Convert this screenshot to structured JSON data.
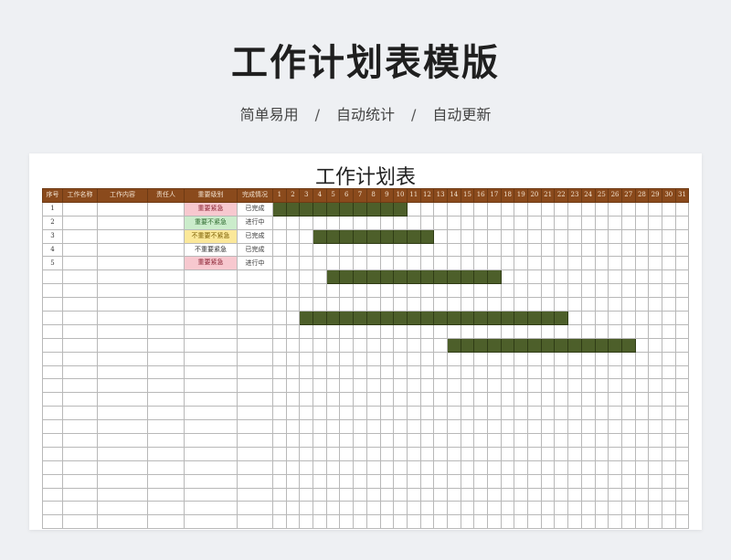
{
  "header": {
    "title": "工作计划表模版",
    "subtitle_items": [
      "简单易用",
      "自动统计",
      "自动更新"
    ],
    "separator": "/"
  },
  "sheet": {
    "title": "工作计划表",
    "columns": [
      "序号",
      "工作名称",
      "工作内容",
      "责任人",
      "重要级别",
      "完成情况"
    ],
    "days": [
      "1",
      "2",
      "3",
      "4",
      "5",
      "6",
      "7",
      "8",
      "9",
      "10",
      "11",
      "12",
      "13",
      "14",
      "15",
      "16",
      "17",
      "18",
      "19",
      "20",
      "21",
      "22",
      "23",
      "24",
      "25",
      "26",
      "27",
      "28",
      "29",
      "30",
      "31"
    ],
    "rows": [
      {
        "no": "1",
        "name": "",
        "content": "",
        "owner": "",
        "priority": "重要紧急",
        "priority_style": "red",
        "status": "已完成",
        "bar": [
          1,
          10
        ]
      },
      {
        "no": "2",
        "name": "",
        "content": "",
        "owner": "",
        "priority": "重要不紧急",
        "priority_style": "green",
        "status": "进行中",
        "bar": null
      },
      {
        "no": "3",
        "name": "",
        "content": "",
        "owner": "",
        "priority": "不重要不紧急",
        "priority_style": "yellow",
        "status": "已完成",
        "bar": [
          4,
          12
        ]
      },
      {
        "no": "4",
        "name": "",
        "content": "",
        "owner": "",
        "priority": "不重要紧急",
        "priority_style": "none",
        "status": "已完成",
        "bar": null
      },
      {
        "no": "5",
        "name": "",
        "content": "",
        "owner": "",
        "priority": "重要紧急",
        "priority_style": "red",
        "status": "进行中",
        "bar": null
      },
      {
        "no": "",
        "name": "",
        "content": "",
        "owner": "",
        "priority": "",
        "priority_style": "",
        "status": "",
        "bar": [
          5,
          17
        ]
      },
      {
        "no": "",
        "name": "",
        "content": "",
        "owner": "",
        "priority": "",
        "priority_style": "",
        "status": "",
        "bar": null
      },
      {
        "no": "",
        "name": "",
        "content": "",
        "owner": "",
        "priority": "",
        "priority_style": "",
        "status": "",
        "bar": null
      },
      {
        "no": "",
        "name": "",
        "content": "",
        "owner": "",
        "priority": "",
        "priority_style": "",
        "status": "",
        "bar": [
          3,
          22
        ]
      },
      {
        "no": "",
        "name": "",
        "content": "",
        "owner": "",
        "priority": "",
        "priority_style": "",
        "status": "",
        "bar": null
      },
      {
        "no": "",
        "name": "",
        "content": "",
        "owner": "",
        "priority": "",
        "priority_style": "",
        "status": "",
        "bar": [
          14,
          27
        ]
      },
      {
        "no": "",
        "name": "",
        "content": "",
        "owner": "",
        "priority": "",
        "priority_style": "",
        "status": "",
        "bar": null
      },
      {
        "no": "",
        "name": "",
        "content": "",
        "owner": "",
        "priority": "",
        "priority_style": "",
        "status": "",
        "bar": null
      },
      {
        "no": "",
        "name": "",
        "content": "",
        "owner": "",
        "priority": "",
        "priority_style": "",
        "status": "",
        "bar": null
      },
      {
        "no": "",
        "name": "",
        "content": "",
        "owner": "",
        "priority": "",
        "priority_style": "",
        "status": "",
        "bar": null
      },
      {
        "no": "",
        "name": "",
        "content": "",
        "owner": "",
        "priority": "",
        "priority_style": "",
        "status": "",
        "bar": null
      },
      {
        "no": "",
        "name": "",
        "content": "",
        "owner": "",
        "priority": "",
        "priority_style": "",
        "status": "",
        "bar": null
      },
      {
        "no": "",
        "name": "",
        "content": "",
        "owner": "",
        "priority": "",
        "priority_style": "",
        "status": "",
        "bar": null
      },
      {
        "no": "",
        "name": "",
        "content": "",
        "owner": "",
        "priority": "",
        "priority_style": "",
        "status": "",
        "bar": null
      },
      {
        "no": "",
        "name": "",
        "content": "",
        "owner": "",
        "priority": "",
        "priority_style": "",
        "status": "",
        "bar": null
      },
      {
        "no": "",
        "name": "",
        "content": "",
        "owner": "",
        "priority": "",
        "priority_style": "",
        "status": "",
        "bar": null
      },
      {
        "no": "",
        "name": "",
        "content": "",
        "owner": "",
        "priority": "",
        "priority_style": "",
        "status": "",
        "bar": null
      },
      {
        "no": "",
        "name": "",
        "content": "",
        "owner": "",
        "priority": "",
        "priority_style": "",
        "status": "",
        "bar": null
      },
      {
        "no": "",
        "name": "",
        "content": "",
        "owner": "",
        "priority": "",
        "priority_style": "",
        "status": "",
        "bar": null
      }
    ]
  },
  "colors": {
    "header_bg": "#8a4a1c",
    "bar": "#4d5f2a",
    "priority_red": "#f7c8cf",
    "priority_green": "#cbeccb",
    "priority_yellow": "#fbe89a"
  }
}
